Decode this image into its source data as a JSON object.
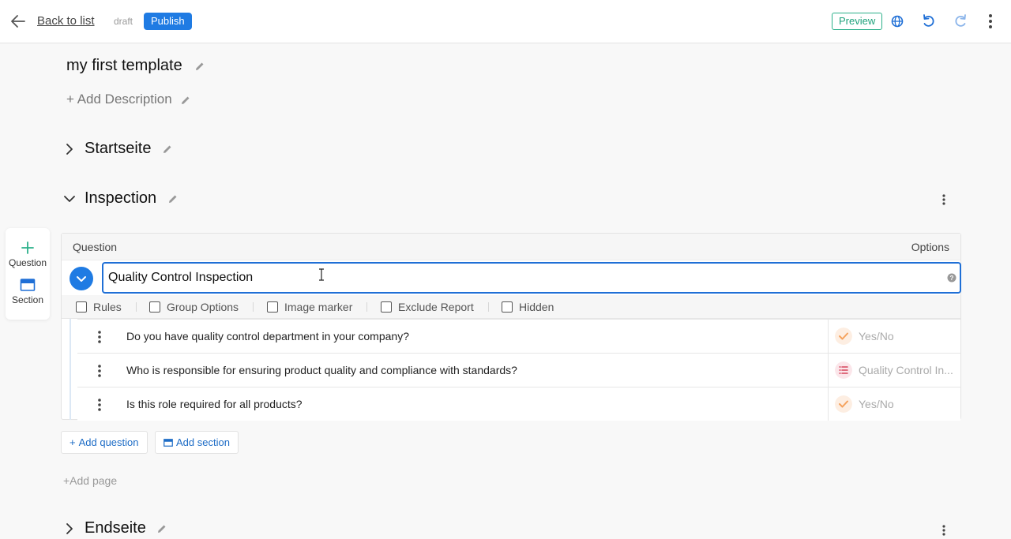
{
  "topbar": {
    "back_label": "Back to list",
    "status": "draft",
    "publish_label": "Publish",
    "preview_label": "Preview"
  },
  "template": {
    "title": "my first template",
    "add_description": "+ Add Description"
  },
  "pages": [
    {
      "name": "Startseite",
      "expanded": false
    },
    {
      "name": "Inspection",
      "expanded": true
    },
    {
      "name": "Endseite",
      "expanded": false
    }
  ],
  "palette": {
    "question_label": "Question",
    "section_label": "Section"
  },
  "section": {
    "header_question": "Question",
    "header_options": "Options",
    "title_value": "Quality Control Inspection",
    "options": [
      "Rules",
      "Group Options",
      "Image marker",
      "Exclude Report",
      "Hidden"
    ],
    "questions": [
      {
        "text": "Do you have quality control department in your company?",
        "type": "Yes/No",
        "type_icon": "check-icon"
      },
      {
        "text": "Who is responsible for ensuring product quality and compliance with standards?",
        "type": "Quality Control In...",
        "type_icon": "list-icon"
      },
      {
        "text": "Is this role required for all products?",
        "type": "Yes/No",
        "type_icon": "check-icon"
      }
    ]
  },
  "actions": {
    "add_question": "Add question",
    "add_section": "Add section",
    "add_page": "+Add page"
  },
  "colors": {
    "primary": "#1f7be3",
    "preview_green": "#2bb08a",
    "yesno_orange": "#f5a25d",
    "list_red": "#d6445b"
  }
}
